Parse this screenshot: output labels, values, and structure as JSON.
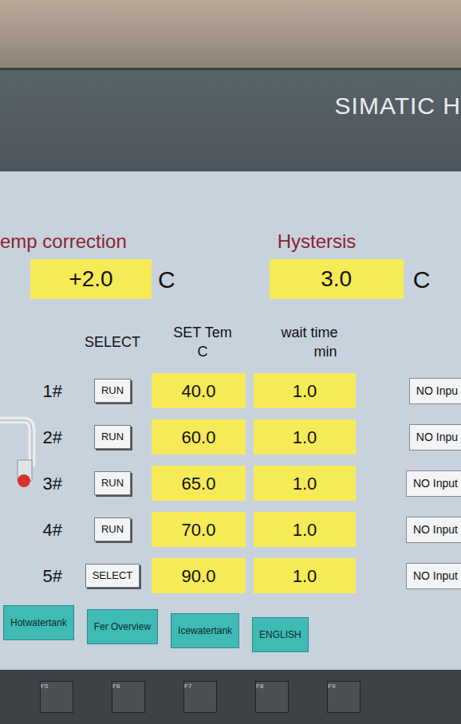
{
  "bezel": {
    "brand": "SIMATIC H"
  },
  "temp_correction": {
    "label": "emp correction",
    "value": "+2.0",
    "unit": "C"
  },
  "hysteresis": {
    "label": "Hystersis",
    "value": "3.0",
    "unit": "C"
  },
  "headers": {
    "select": "SELECT",
    "set_temp": "SET Tem",
    "set_temp_unit": "C",
    "wait_time": "wait time",
    "wait_time_unit": "min"
  },
  "rows": [
    {
      "index": "1#",
      "button": "RUN",
      "set_temp": "40.0",
      "wait_time": "1.0",
      "input": "NO Inpu"
    },
    {
      "index": "2#",
      "button": "RUN",
      "set_temp": "60.0",
      "wait_time": "1.0",
      "input": "NO Inpu"
    },
    {
      "index": "3#",
      "button": "RUN",
      "set_temp": "65.0",
      "wait_time": "1.0",
      "input": "NO Input"
    },
    {
      "index": "4#",
      "button": "RUN",
      "set_temp": "70.0",
      "wait_time": "1.0",
      "input": "NO Input"
    },
    {
      "index": "5#",
      "button": "SELECT",
      "set_temp": "90.0",
      "wait_time": "1.0",
      "input": "NO Input"
    }
  ],
  "nav_buttons": [
    "Hotwatertank",
    "Fer Overview",
    "Icewatertank",
    "ENGLISH"
  ],
  "function_keys": [
    "F5",
    "F6",
    "F7",
    "F8",
    "F9"
  ]
}
